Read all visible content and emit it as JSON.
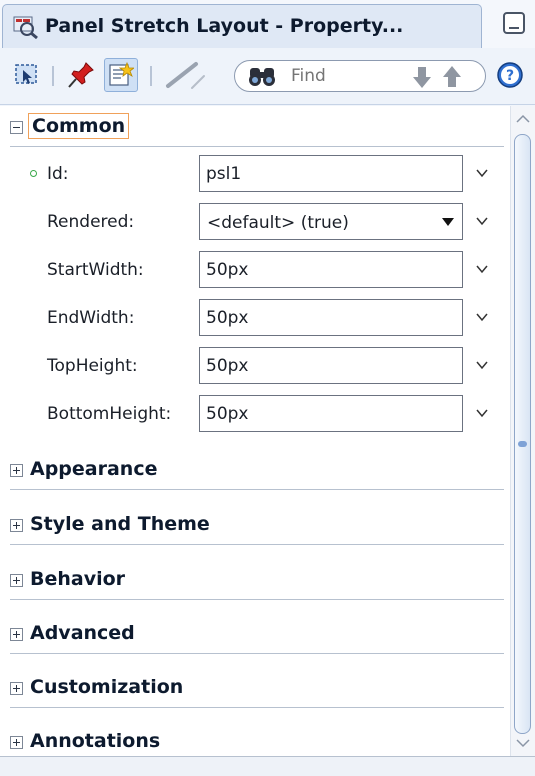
{
  "window": {
    "title": "Panel Stretch Layout - Property..."
  },
  "toolbar": {
    "find_placeholder": "Find",
    "buttons": [
      "select-icon",
      "pin-icon",
      "edit-properties-icon",
      "pencil-icon",
      "binoculars-icon",
      "arrow-down-icon",
      "arrow-up-icon",
      "help-icon"
    ]
  },
  "sections": {
    "common": {
      "title": "Common",
      "expander": "⊟",
      "properties": {
        "id": {
          "label": "Id:",
          "value": "psl1",
          "required": true
        },
        "rendered": {
          "label": "Rendered:",
          "value": "<default> (true)"
        },
        "start_width": {
          "label": "StartWidth:",
          "value": "50px"
        },
        "end_width": {
          "label": "EndWidth:",
          "value": "50px"
        },
        "top_height": {
          "label": "TopHeight:",
          "value": "50px"
        },
        "bottom_height": {
          "label": "BottomHeight:",
          "value": "50px"
        }
      }
    },
    "appearance": {
      "title": "Appearance",
      "expander": "⊞"
    },
    "style_theme": {
      "title": "Style and Theme",
      "expander": "⊞"
    },
    "behavior": {
      "title": "Behavior",
      "expander": "⊞"
    },
    "advanced": {
      "title": "Advanced",
      "expander": "⊞"
    },
    "customization": {
      "title": "Customization",
      "expander": "⊞"
    },
    "annotations": {
      "title": "Annotations",
      "expander": "⊞"
    }
  },
  "colors": {
    "accent": "#8fb0da",
    "required_dot": "#3aa84a",
    "focus": "#f0a15a"
  }
}
